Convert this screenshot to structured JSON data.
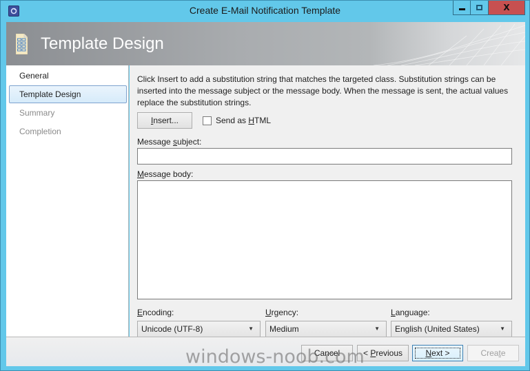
{
  "window": {
    "title": "Create E-Mail Notification Template",
    "controls": {
      "minimize": "minimize",
      "maximize": "maximize",
      "close": "X"
    }
  },
  "header": {
    "title": "Template Design",
    "icon": "template-document-icon"
  },
  "sidebar": {
    "items": [
      {
        "label": "General",
        "state": "normal"
      },
      {
        "label": "Template Design",
        "state": "active"
      },
      {
        "label": "Summary",
        "state": "disabled"
      },
      {
        "label": "Completion",
        "state": "disabled"
      }
    ]
  },
  "content": {
    "description": "Click Insert to add a substitution string that matches the targeted class. Substitution strings can be inserted into the message subject or the message body. When the message is sent, the actual values replace the substitution strings.",
    "insert_button": {
      "pre": "",
      "mnemonic": "I",
      "post": "nsert..."
    },
    "send_as_html": {
      "pre": "Send as ",
      "mnemonic": "H",
      "post": "TML",
      "checked": false
    },
    "subject_label": {
      "pre": "Message ",
      "mnemonic": "s",
      "post": "ubject:"
    },
    "subject_value": "",
    "body_label": {
      "pre": "",
      "mnemonic": "M",
      "post": "essage body:"
    },
    "body_value": "",
    "encoding": {
      "label_mnemonic": "E",
      "label_rest": "ncoding:",
      "value": "Unicode (UTF-8)"
    },
    "urgency": {
      "label_mnemonic": "U",
      "label_rest": "rgency:",
      "value": "Medium"
    },
    "language": {
      "label_mnemonic": "L",
      "label_rest": "anguage:",
      "value": "English (United States)"
    }
  },
  "footer": {
    "cancel": "Cancel",
    "previous": {
      "pre": "< ",
      "mnemonic": "P",
      "post": "revious"
    },
    "next": {
      "pre": "",
      "mnemonic": "N",
      "post": "ext >"
    },
    "create": {
      "pre": "Crea",
      "mnemonic": "t",
      "post": "e"
    }
  },
  "watermark": "windows-noob.com"
}
